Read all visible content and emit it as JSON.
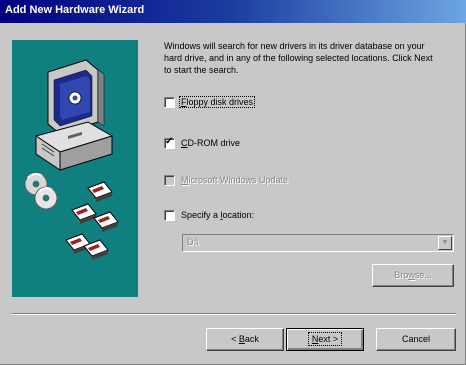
{
  "window": {
    "title": "Add New Hardware Wizard"
  },
  "art": {
    "icons": [
      "computer-icon",
      "cd-disc-icon",
      "floppy-disk-icon"
    ]
  },
  "instructions": "Windows will search for new drivers in its driver database on your\nhard drive, and in any of the following selected locations. Click Next\nto start the search.",
  "options": [
    {
      "label_pre": "",
      "label_underlined": "F",
      "label_post": "loppy disk drives",
      "checked": false,
      "enabled": true,
      "focused": true
    },
    {
      "label_pre": "",
      "label_underlined": "C",
      "label_post": "D-ROM drive",
      "checked": true,
      "enabled": true,
      "focused": false
    },
    {
      "label_pre": "",
      "label_underlined": "M",
      "label_post": "icrosoft Windows Update",
      "checked": false,
      "enabled": false,
      "focused": false
    },
    {
      "label_pre": "Specify a ",
      "label_underlined": "l",
      "label_post": "ocation:",
      "checked": false,
      "enabled": true,
      "focused": false
    }
  ],
  "location": {
    "value": "D:\\",
    "enabled": false
  },
  "buttons": {
    "browse": {
      "pre": "Bro",
      "u": "w",
      "post": "se...",
      "enabled": false
    },
    "back": {
      "pre": "< ",
      "u": "B",
      "post": "ack"
    },
    "next": {
      "pre": "",
      "u": "N",
      "post": "ext >"
    },
    "cancel": {
      "label": "Cancel"
    }
  },
  "colors": {
    "title_start": "#000080",
    "title_end": "#6da6e2",
    "face": "#c8c8c8",
    "art_background": "#0f7f7f"
  }
}
